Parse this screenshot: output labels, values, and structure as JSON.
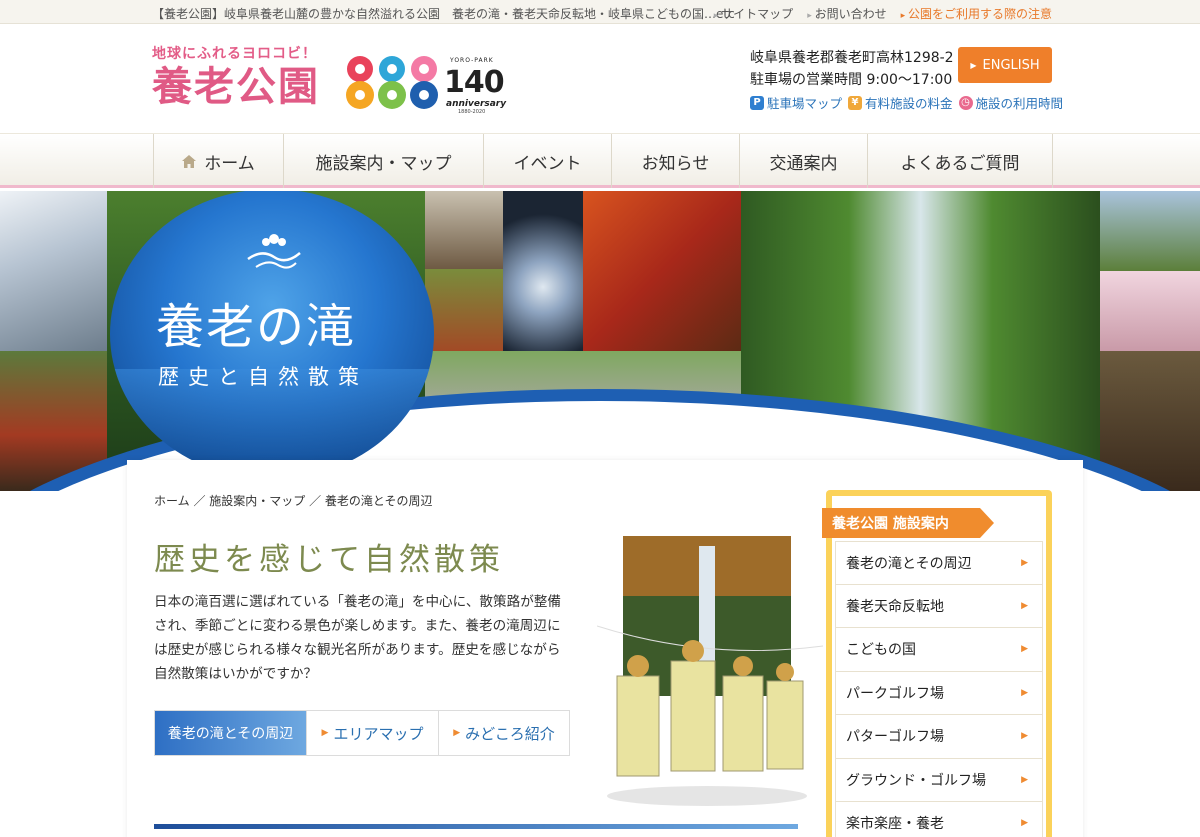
{
  "topbar": {
    "tagline": "【養老公園】岐阜県養老山麓の豊かな自然溢れる公園　養老の滝・養老天命反転地・岐阜県こどもの国…etc",
    "links": [
      "サイトマップ",
      "お問い合わせ"
    ],
    "notice": "公園をご利用する際の注意"
  },
  "header": {
    "catchphrase": "地球にふれるヨロコビ！",
    "logo_text": "養老公園",
    "anniversary": {
      "yoro_park": "YORO-PARK",
      "number": "140",
      "label": "anniversary",
      "years": "1880-2020"
    },
    "address": "岐阜県養老郡養老町高林1298-2",
    "hours": "駐車場の営業時間 9:00〜17:00",
    "english_button": "ENGLISH",
    "info_links": [
      {
        "icon": "parking-icon",
        "glyph": "P",
        "label": "駐車場マップ"
      },
      {
        "icon": "yen-icon",
        "glyph": "¥",
        "label": "有料施設の料金"
      },
      {
        "icon": "clock-icon",
        "glyph": "◷",
        "label": "施設の利用時間"
      }
    ]
  },
  "nav": {
    "items": [
      "ホーム",
      "施設案内・マップ",
      "イベント",
      "お知らせ",
      "交通案内",
      "よくあるご質問"
    ]
  },
  "hero": {
    "title": "養老の滝",
    "subtitle": "歴史と自然散策"
  },
  "main": {
    "breadcrumb": "ホーム ／ 施設案内・マップ ／ 養老の滝とその周辺",
    "heading": "歴史を感じて自然散策",
    "intro": "日本の滝百選に選ばれている「養老の滝」を中心に、散策路が整備され、季節ごとに変わる景色が楽しめます。また、養老の滝周辺には歴史が感じられる様々な観光名所があります。歴史を感じながら自然散策はいかがですか？",
    "tabs": [
      {
        "label": "養老の滝とその周辺",
        "active": true
      },
      {
        "label": "エリアマップ",
        "active": false
      },
      {
        "label": "みどころ紹介",
        "active": false
      }
    ]
  },
  "sidebar": {
    "heading": "養老公園 施設案内",
    "items": [
      "養老の滝とその周辺",
      "養老天命反転地",
      "こどもの国",
      "パークゴルフ場",
      "パターゴルフ場",
      "グラウンド・ゴルフ場",
      "楽市楽座・養老"
    ]
  },
  "colors": {
    "accent_orange": "#ef7f2a",
    "logo_pink": "#e05a85",
    "link_blue": "#2a73b9",
    "heading_olive": "#7d8a4f",
    "sidebar_yellow": "#fbd25a"
  }
}
